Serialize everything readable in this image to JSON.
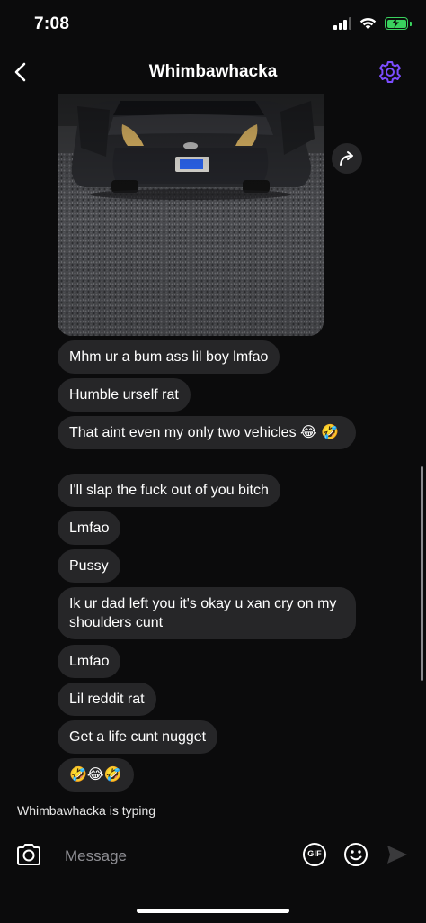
{
  "status_bar": {
    "time": "7:08"
  },
  "header": {
    "title": "Whimbawhacka"
  },
  "colors": {
    "accent": "#7c4dff",
    "bubble": "#262628",
    "battery": "#3ad15e"
  },
  "messages": [
    {
      "text": "Mhm ur a bum ass lil boy lmfao"
    },
    {
      "text": "Humble urself rat"
    },
    {
      "text": "That aint even my only two vehicles 😂 🤣"
    },
    {
      "text": "I'll slap the fuck out of you bitch"
    },
    {
      "text": "Lmfao"
    },
    {
      "text": "Pussy"
    },
    {
      "text": "Ik ur dad left you it's okay u xan cry on my shoulders cunt"
    },
    {
      "text": "Lmfao"
    },
    {
      "text": "Lil reddit rat"
    },
    {
      "text": "Get a life cunt nugget"
    },
    {
      "text": "🤣😂🤣"
    }
  ],
  "typing_indicator": "Whimbawhacka is typing",
  "composer": {
    "placeholder": "Message",
    "gif_label": "GIF"
  },
  "icons": {
    "back": "chevron-left-icon",
    "settings": "gear-icon",
    "share": "share-icon",
    "camera": "camera-icon",
    "gif": "gif-icon",
    "emoji": "emoji-icon",
    "send": "send-icon"
  }
}
